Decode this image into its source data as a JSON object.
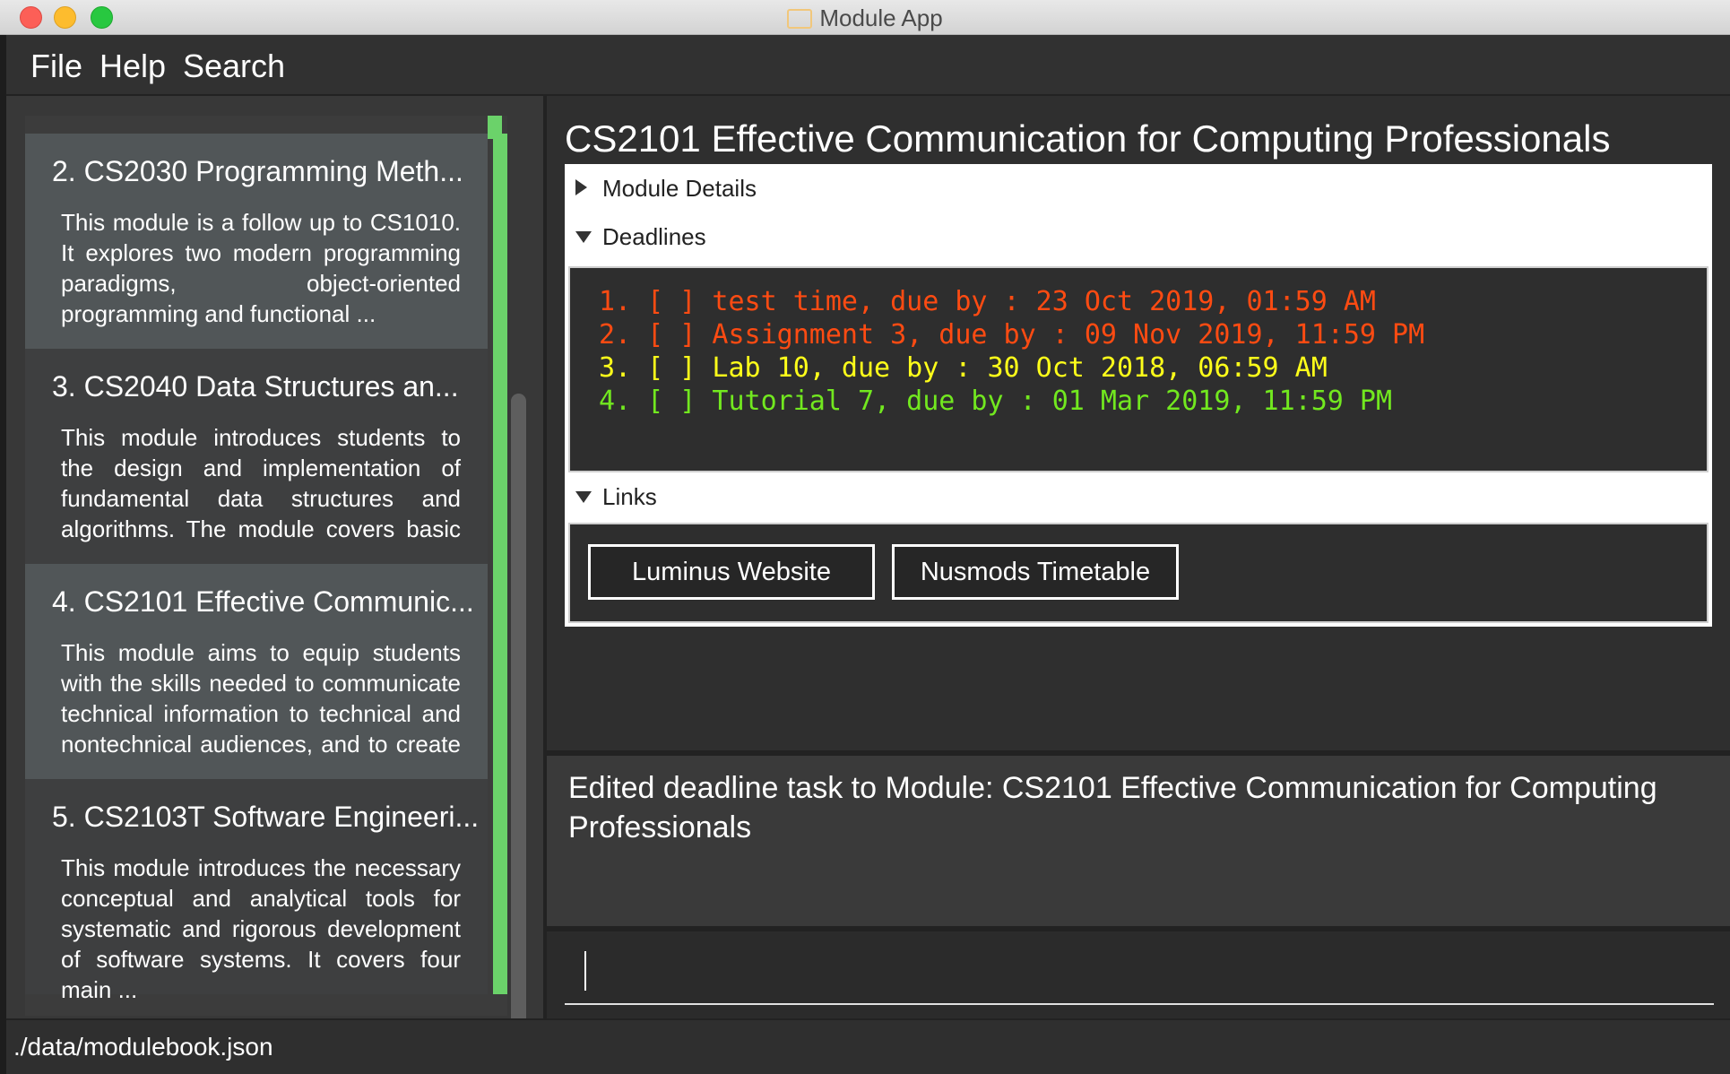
{
  "window": {
    "title": "Module App"
  },
  "menu": {
    "items": [
      "File",
      "Help",
      "Search"
    ]
  },
  "modules": [
    {
      "title": "2.  CS2030 Programming Meth...",
      "description": "This module is a follow up to CS1010. It explores two modern programming paradigms, object-oriented programming and functional ..."
    },
    {
      "title": "3.  CS2040 Data Structures an...",
      "description": "This module introduces students to the design and implementation of fundamental data structures and algorithms. The module covers basic ..."
    },
    {
      "title": "4.  CS2101 Effective Communic...",
      "description": "This module aims to equip students with the skills needed to communicate technical information to technical and nontechnical audiences, and to create ..."
    },
    {
      "title": "5.  CS2103T Software Engineeri...",
      "description": "This module introduces the necessary conceptual and analytical tools for systematic and rigorous development of software systems. It covers four main ..."
    }
  ],
  "detail": {
    "title": "CS2101 Effective Communication for Computing Professionals",
    "sections": {
      "details": "Module Details",
      "deadlines": "Deadlines",
      "links": "Links"
    },
    "deadlines": [
      {
        "text": "1. [ ] test time, due by : 23 Oct 2019, 01:59 AM",
        "color": "#ff4b12"
      },
      {
        "text": "2. [ ] Assignment 3, due by : 09 Nov 2019, 11:59 PM",
        "color": "#ff4b12"
      },
      {
        "text": "3. [ ] Lab 10, due by : 30 Oct 2018, 06:59 AM",
        "color": "#ffff1a"
      },
      {
        "text": "4. [ ] Tutorial 7, due by : 01 Mar 2019, 11:59 PM",
        "color": "#72e81f"
      }
    ],
    "links": [
      "Luminus Website",
      "Nusmods Timetable"
    ]
  },
  "result": {
    "text": "Edited deadline task to Module: CS2101 Effective Communication for Computing Professionals"
  },
  "command": {
    "value": ""
  },
  "status": {
    "path": "./data/modulebook.json"
  },
  "colors": {
    "accent": "#6bd26a"
  }
}
